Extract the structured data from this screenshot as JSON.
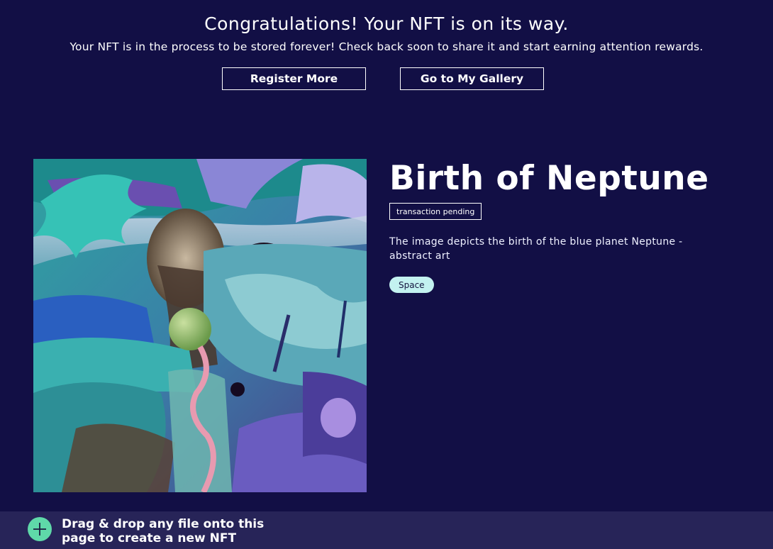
{
  "banner": {
    "title": "Congratulations! Your NFT is on its way.",
    "subtitle": "Your NFT is in the process to be stored forever! Check back soon to share it and start earning attention rewards.",
    "register_label": "Register More",
    "gallery_label": "Go to My Gallery"
  },
  "nft": {
    "title": "Birth of Neptune",
    "status": "transaction pending",
    "description": "The image depicts the birth of the blue planet Neptune - abstract art",
    "tags": [
      "Space"
    ]
  },
  "dropzone": {
    "text": "Drag & drop any file onto this page to create a new NFT",
    "icon": "plus-icon"
  },
  "colors": {
    "background": "#120f45",
    "dropbar": "#272458",
    "accent_green": "#5fd9a9",
    "tag_bg": "#c3f2f0"
  }
}
